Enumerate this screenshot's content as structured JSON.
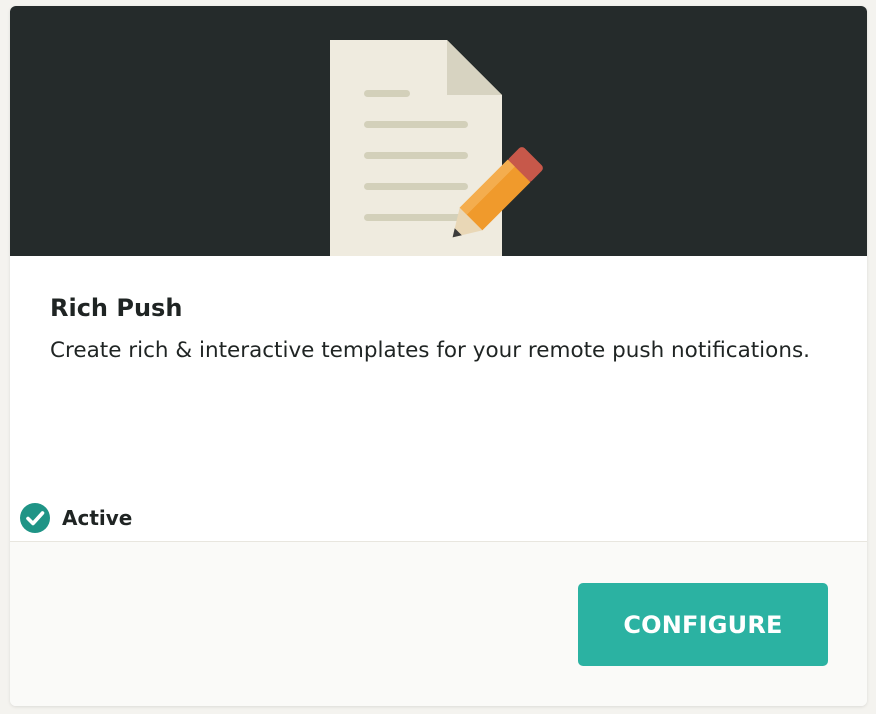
{
  "card": {
    "title": "Rich Push",
    "description": "Create rich & interactive templates for your remote push notifications.",
    "status_label": "Active",
    "button_label": "CONFIGURE",
    "hero_icon": "document-pencil-icon",
    "status_icon": "check-circle-icon"
  },
  "colors": {
    "hero_background": "#252b2b",
    "accent": "#2bb2a2",
    "paper": "#efebdf",
    "paper_lines": "#d3d0ba",
    "pencil": "#f09a2c",
    "pencil_eraser": "#c7584a",
    "status_check": "#1f9486",
    "text": "#1f2423"
  }
}
